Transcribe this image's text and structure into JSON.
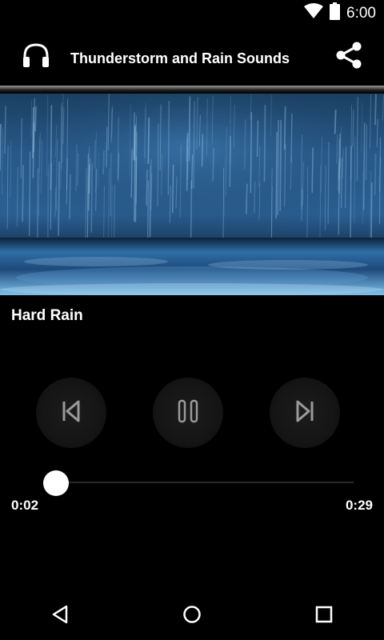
{
  "status_bar": {
    "time": "6:00",
    "icons": [
      "wifi-icon",
      "battery-icon"
    ]
  },
  "toolbar": {
    "title": "Thunderstorm and Rain Sounds",
    "left_icon": "headphones-icon",
    "right_icon": "share-icon"
  },
  "hero": {
    "image": "rain-on-water"
  },
  "track": {
    "title": "Hard Rain"
  },
  "controls": {
    "previous_icon": "skip-previous-icon",
    "pause_icon": "pause-icon",
    "next_icon": "skip-next-icon"
  },
  "progress": {
    "elapsed": "0:02",
    "total": "0:29",
    "fraction": 0.069
  },
  "nav_bar": {
    "icons": [
      "back-icon",
      "home-icon",
      "recents-icon"
    ]
  },
  "colors": {
    "background": "#000000",
    "text": "#ffffff",
    "hero_blue": "#2b5f93"
  }
}
